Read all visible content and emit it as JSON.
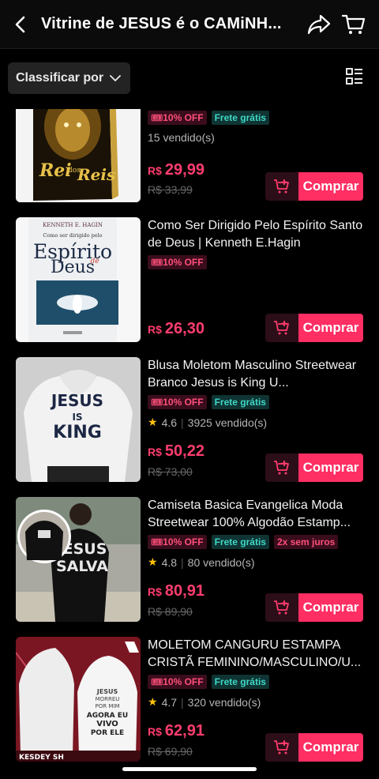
{
  "header": {
    "title": "Vitrine de JESUS é o CAMiNH...",
    "back_icon": "chevron-left-icon",
    "share_icon": "share-arrow-icon",
    "cart_icon": "cart-icon"
  },
  "filter": {
    "sort_label": "Classificar por",
    "view_icon": "list-view-icon"
  },
  "colors": {
    "accent": "#ff2e63",
    "price": "#ff3d6e",
    "discount_bg": "#3a0d1c",
    "free_shipping": "#3fd8c6",
    "rating_star": "#ffc107"
  },
  "products": [
    {
      "title": "",
      "discount": "10% OFF",
      "free_shipping": "Frete grátis",
      "installments": "",
      "rating": "",
      "sold": "15 vendido(s)",
      "currency": "R$",
      "price": "29,99",
      "old_price": "R$ 33,99",
      "buy_label": "Comprar",
      "image_text": [
        "Rei",
        "dos",
        "Reis"
      ]
    },
    {
      "title": "Como Ser Dirigido Pelo Espírito Santo de Deus | Kenneth E.Hagin",
      "discount": "10% OFF",
      "free_shipping": "",
      "installments": "",
      "rating": "",
      "sold": "",
      "currency": "R$",
      "price": "26,30",
      "old_price": "",
      "buy_label": "Comprar",
      "image_text": [
        "KENNETH E. HAGIN",
        "Como ser dirigido pelo",
        "Espírito",
        "de",
        "Deus"
      ]
    },
    {
      "title": "Blusa Moletom Masculino Streetwear Branco Jesus is King U...",
      "discount": "10% OFF",
      "free_shipping": "Frete grátis",
      "installments": "",
      "rating": "4.6",
      "sold": "3925 vendido(s)",
      "currency": "R$",
      "price": "50,22",
      "old_price": "R$ 73,00",
      "buy_label": "Comprar",
      "image_text": [
        "JESUS",
        "IS",
        "KING"
      ]
    },
    {
      "title": "Camiseta Basica Evangelica Moda Streetwear 100% Algodão Estamp...",
      "discount": "10% OFF",
      "free_shipping": "Frete grátis",
      "installments": "2x sem juros",
      "rating": "4.8",
      "sold": "80 vendido(s)",
      "currency": "R$",
      "price": "80,91",
      "old_price": "R$ 89,90",
      "buy_label": "Comprar",
      "image_text": [
        "JESUS",
        "SALVA"
      ]
    },
    {
      "title": "MOLETOM CANGURU ESTAMPA CRISTÃ FEMININO/MASCULINO/U...",
      "discount": "10% OFF",
      "free_shipping": "Frete grátis",
      "installments": "",
      "rating": "4.7",
      "sold": "320 vendido(s)",
      "currency": "R$",
      "price": "62,91",
      "old_price": "R$ 69,90",
      "buy_label": "Comprar",
      "image_text": [
        "JESUS",
        "MORREU",
        "POR MIM",
        "AGORA EU",
        "VIVO",
        "POR ELE",
        "KESDEY SH"
      ]
    }
  ]
}
